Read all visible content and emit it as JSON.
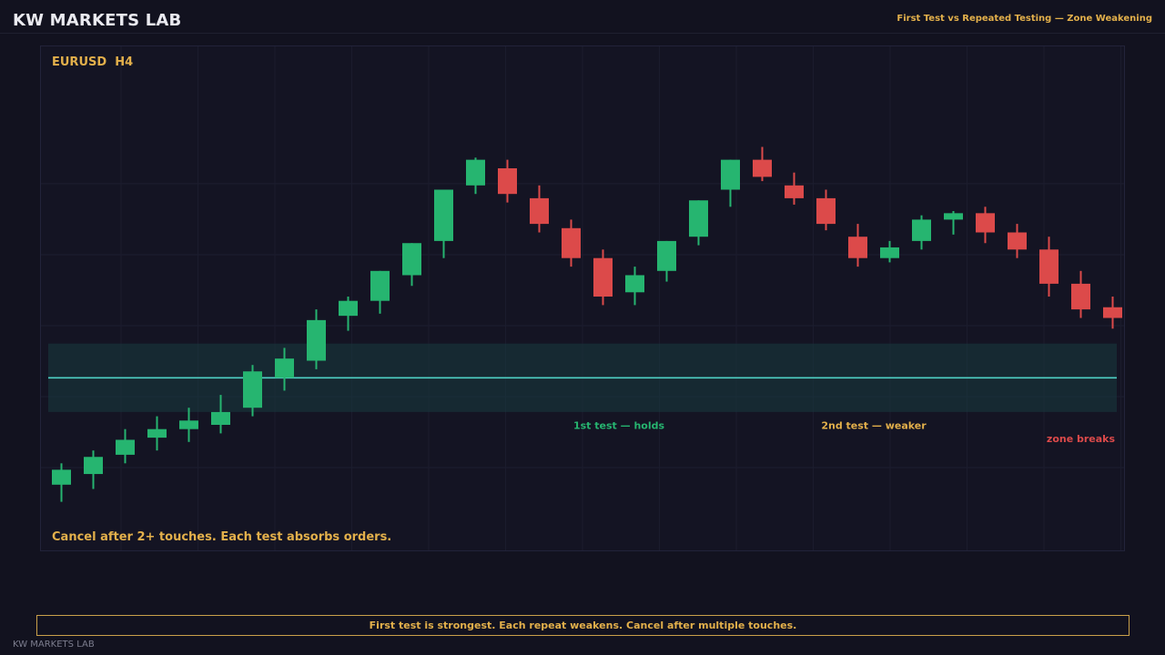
{
  "header": {
    "brand": "KW MARKETS LAB",
    "subtitle": "First Test vs Repeated Testing — Zone Weakening"
  },
  "chart_data": {
    "type": "candlestick",
    "title": "EURUSD  H4",
    "note": "Cancel after 2+ touches. Each test absorbs orders.",
    "ylim": [
      0,
      100
    ],
    "grid": true,
    "zone": {
      "low": 23,
      "high": 39,
      "level": 31,
      "color": "#4fd1c5"
    },
    "colors": {
      "up": "#26b570",
      "down": "#dc4a4a"
    },
    "candles": [
      {
        "o": 6,
        "h": 11,
        "l": 2,
        "c": 9.5
      },
      {
        "o": 8.5,
        "h": 14,
        "l": 5,
        "c": 12.5
      },
      {
        "o": 13,
        "h": 19,
        "l": 11,
        "c": 16.5
      },
      {
        "o": 17,
        "h": 22,
        "l": 14,
        "c": 19
      },
      {
        "o": 19,
        "h": 24,
        "l": 16,
        "c": 21
      },
      {
        "o": 20,
        "h": 27,
        "l": 18,
        "c": 23
      },
      {
        "o": 24,
        "h": 34,
        "l": 22,
        "c": 32.5
      },
      {
        "o": 31,
        "h": 38,
        "l": 28,
        "c": 35.5
      },
      {
        "o": 35,
        "h": 47,
        "l": 33,
        "c": 44.5
      },
      {
        "o": 45.5,
        "h": 50,
        "l": 42,
        "c": 49
      },
      {
        "o": 49,
        "h": 55,
        "l": 46,
        "c": 56
      },
      {
        "o": 55,
        "h": 59,
        "l": 52.5,
        "c": 62.5
      },
      {
        "o": 63,
        "h": 73,
        "l": 59,
        "c": 75
      },
      {
        "o": 76,
        "h": 82.5,
        "l": 74,
        "c": 82
      },
      {
        "o": 80,
        "h": 82,
        "l": 72,
        "c": 74
      },
      {
        "o": 73,
        "h": 76,
        "l": 65,
        "c": 67
      },
      {
        "o": 66,
        "h": 68,
        "l": 57,
        "c": 59
      },
      {
        "o": 59,
        "h": 61,
        "l": 48,
        "c": 50
      },
      {
        "o": 51,
        "h": 57,
        "l": 48,
        "c": 55
      },
      {
        "o": 56,
        "h": 63,
        "l": 53.5,
        "c": 63
      },
      {
        "o": 64,
        "h": 70,
        "l": 62,
        "c": 72.5
      },
      {
        "o": 75,
        "h": 82,
        "l": 71,
        "c": 82
      },
      {
        "o": 82,
        "h": 85,
        "l": 77,
        "c": 78
      },
      {
        "o": 76,
        "h": 79,
        "l": 71.5,
        "c": 73
      },
      {
        "o": 73,
        "h": 75,
        "l": 65.5,
        "c": 67
      },
      {
        "o": 64,
        "h": 67,
        "l": 57,
        "c": 59
      },
      {
        "o": 59,
        "h": 63,
        "l": 58,
        "c": 61.5
      },
      {
        "o": 63,
        "h": 69,
        "l": 61,
        "c": 68
      },
      {
        "o": 68,
        "h": 70,
        "l": 64.5,
        "c": 69.5
      },
      {
        "o": 69.5,
        "h": 71,
        "l": 62.5,
        "c": 65
      },
      {
        "o": 65,
        "h": 67,
        "l": 59,
        "c": 61
      },
      {
        "o": 61,
        "h": 64,
        "l": 50,
        "c": 53
      },
      {
        "o": 53,
        "h": 56,
        "l": 45,
        "c": 47
      },
      {
        "o": 47.5,
        "h": 50,
        "l": 42.5,
        "c": 45
      }
    ],
    "annotations": [
      {
        "text": "1st test — holds",
        "candle": 17.5,
        "y": 19,
        "color": "#26b570"
      },
      {
        "text": "2nd test — weaker",
        "candle": 25.5,
        "y": 19,
        "color": "#e3b04b"
      },
      {
        "text": "zone breaks",
        "candle": 32,
        "y": 16,
        "color": "#dc4a4a"
      }
    ]
  },
  "footer": {
    "message": "First test is strongest. Each repeat weakens. Cancel after multiple touches.",
    "brand": "KW MARKETS LAB"
  }
}
